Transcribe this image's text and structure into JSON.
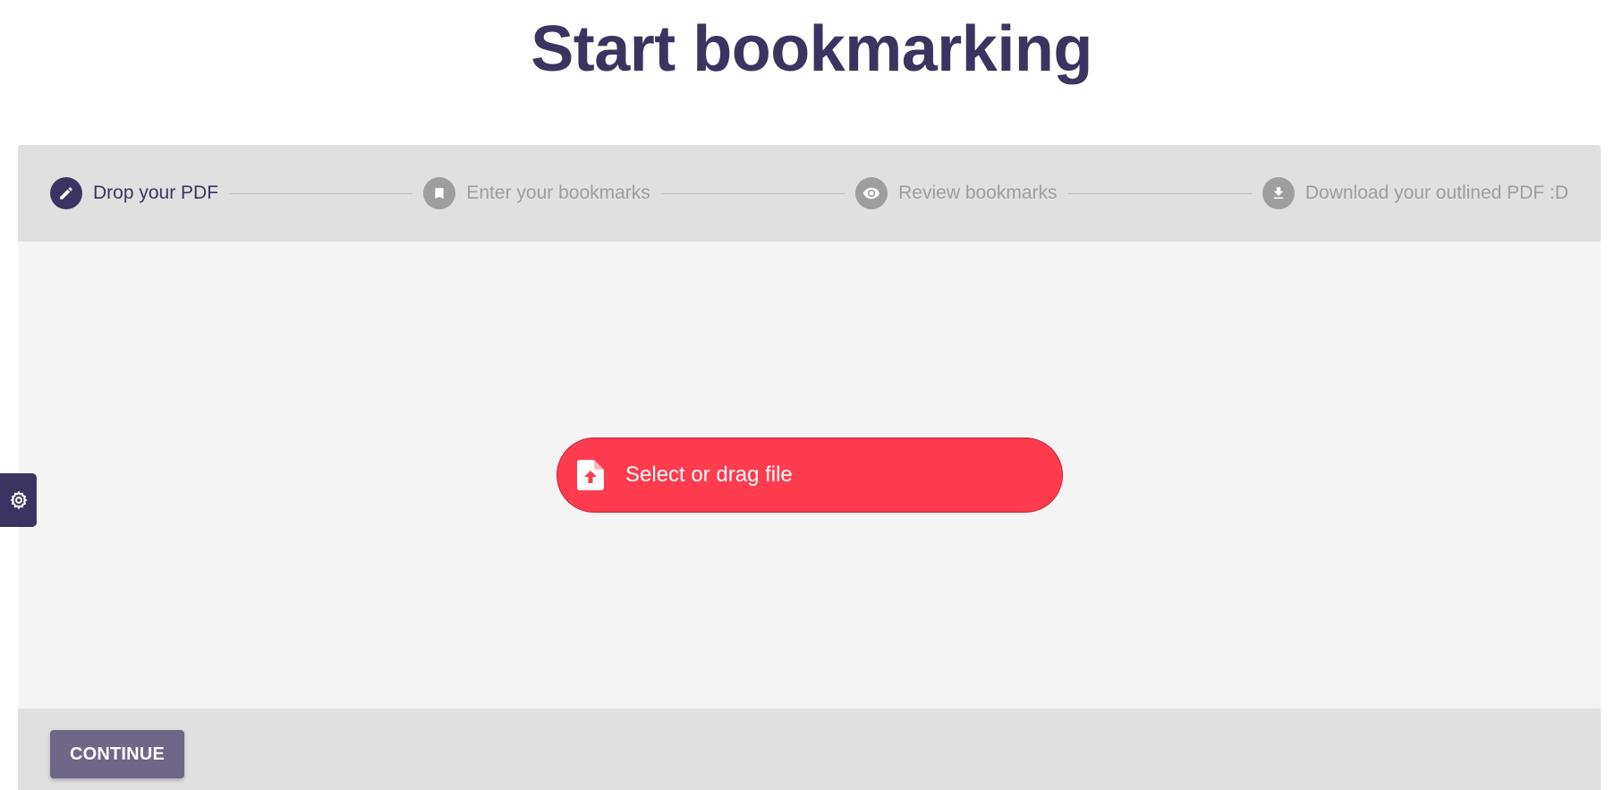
{
  "page": {
    "title": "Start bookmarking"
  },
  "stepper": {
    "steps": [
      {
        "label": "Drop your PDF",
        "icon": "pencil-icon",
        "active": true
      },
      {
        "label": "Enter your bookmarks",
        "icon": "bookmark-icon",
        "active": false
      },
      {
        "label": "Review bookmarks",
        "icon": "eye-icon",
        "active": false
      },
      {
        "label": "Download your outlined PDF :D",
        "icon": "download-icon",
        "active": false
      }
    ]
  },
  "upload": {
    "label": "Select or drag file",
    "icon": "file-upload-icon"
  },
  "footer": {
    "continue_label": "CONTINUE"
  },
  "settings": {
    "icon": "gear-icon"
  },
  "colors": {
    "brand": "#3b3461",
    "accent": "#ff3b4e",
    "inactive": "#9e9e9e",
    "button": "#6e6787"
  }
}
